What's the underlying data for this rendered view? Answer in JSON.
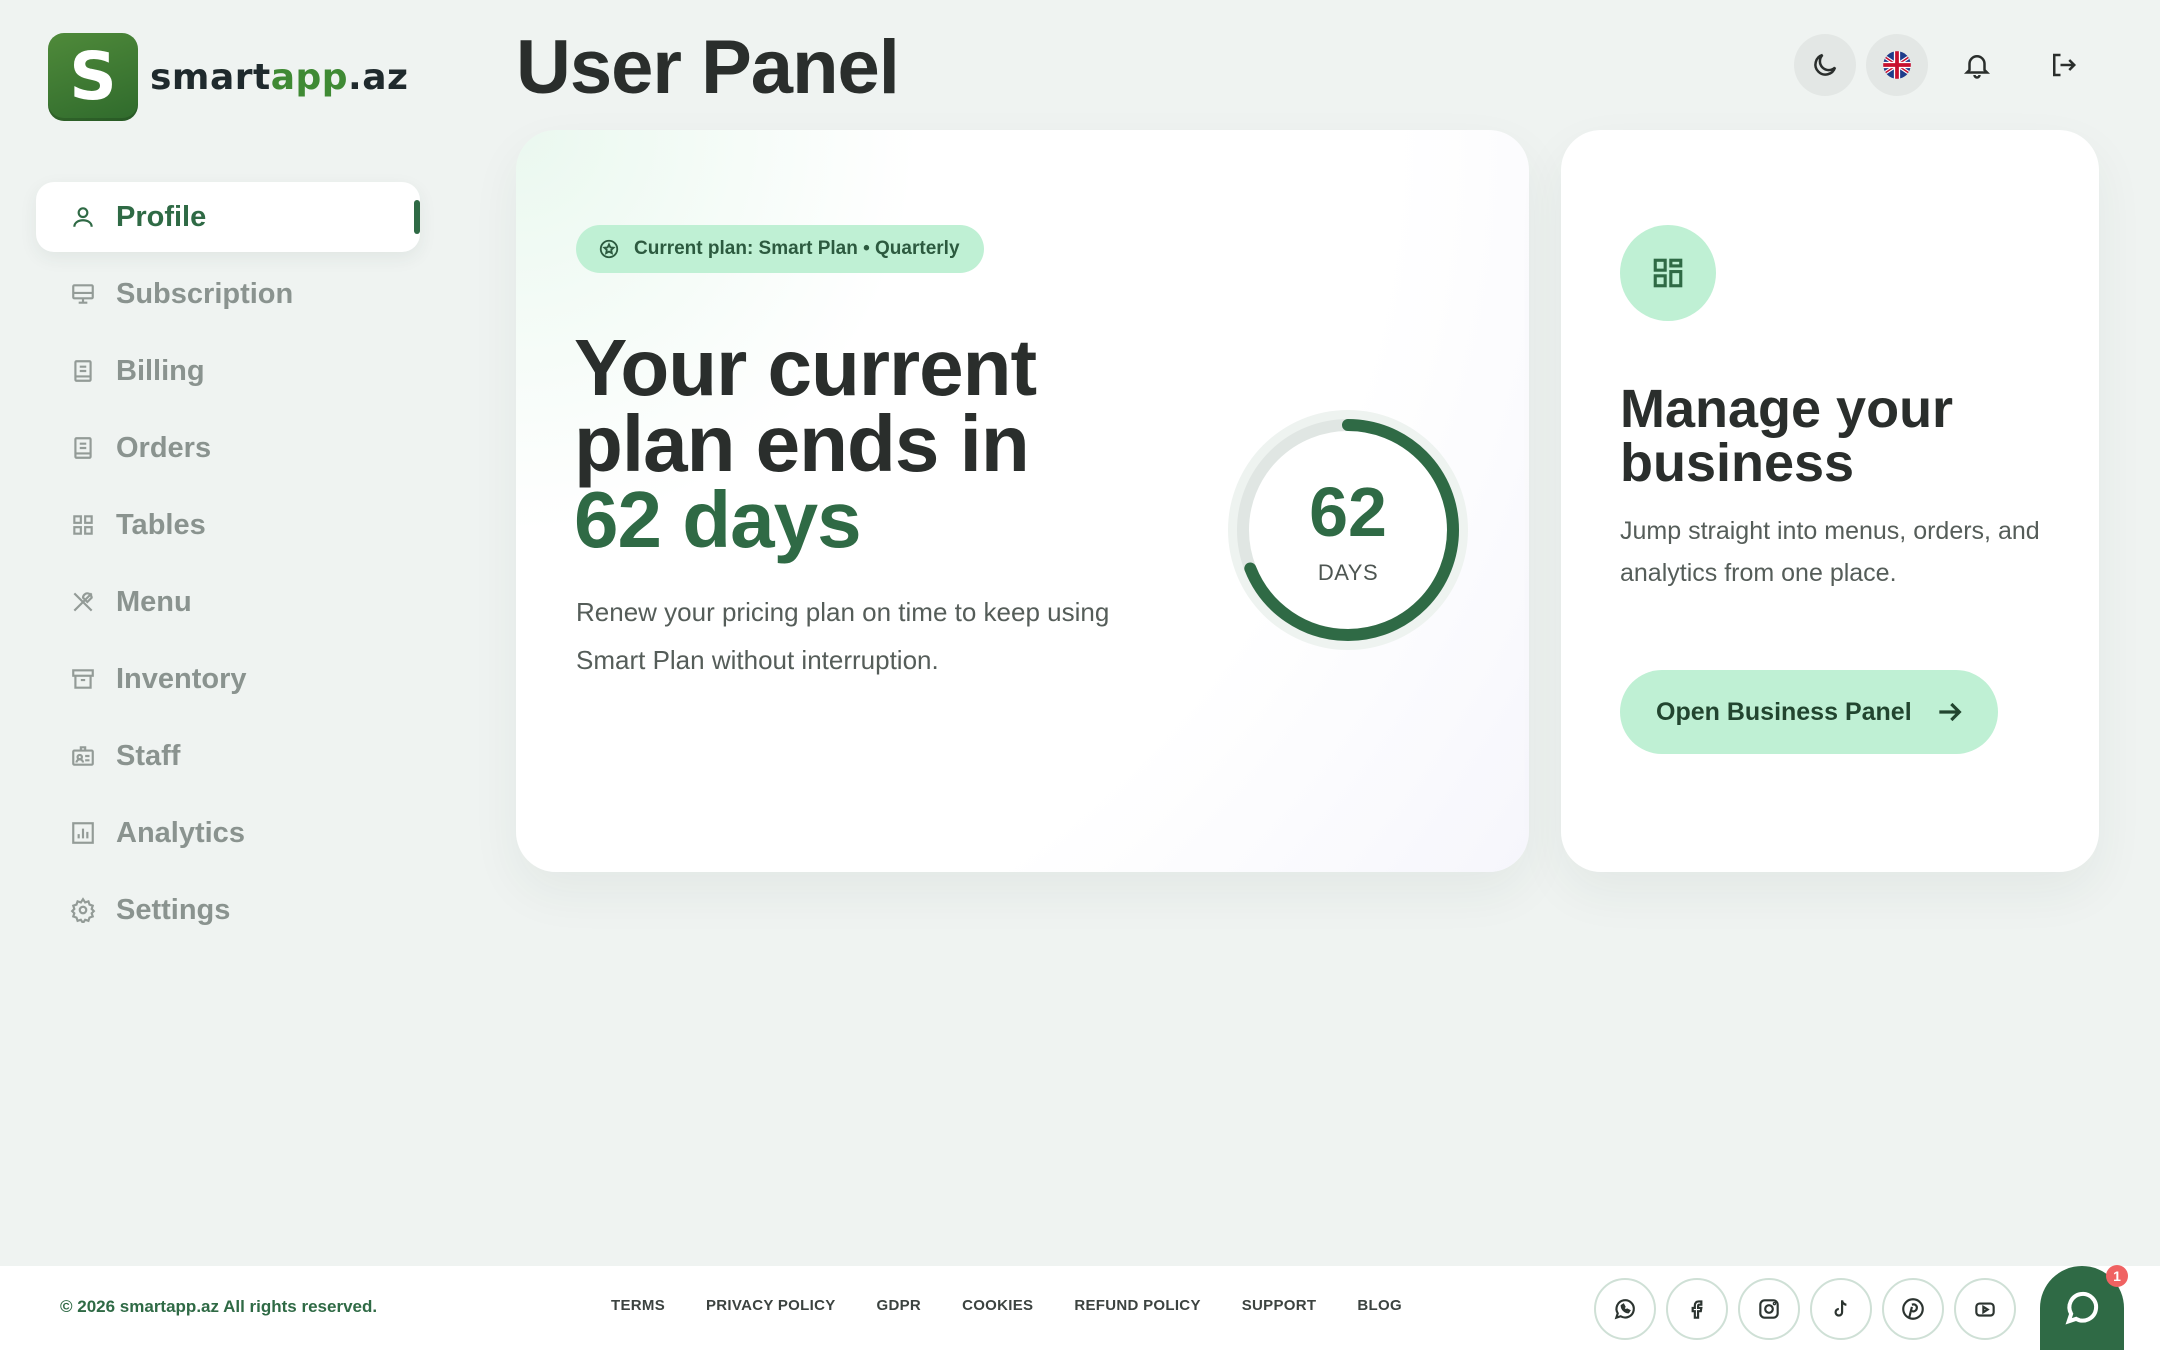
{
  "brand": {
    "logo_letter": "S",
    "name_part1": "smart",
    "name_part2": "app",
    "name_part3": ".az"
  },
  "page": {
    "title": "User Panel"
  },
  "sidebar": {
    "items": [
      {
        "label": "Profile",
        "icon": "user-icon",
        "active": true
      },
      {
        "label": "Subscription",
        "icon": "monitor-icon"
      },
      {
        "label": "Billing",
        "icon": "receipt-icon"
      },
      {
        "label": "Orders",
        "icon": "receipt-icon"
      },
      {
        "label": "Tables",
        "icon": "grid-icon"
      },
      {
        "label": "Menu",
        "icon": "utensils-icon"
      },
      {
        "label": "Inventory",
        "icon": "archive-icon"
      },
      {
        "label": "Staff",
        "icon": "id-card-icon"
      },
      {
        "label": "Analytics",
        "icon": "chart-icon"
      },
      {
        "label": "Settings",
        "icon": "gear-icon"
      }
    ]
  },
  "plan": {
    "chip": "Current plan: Smart Plan • Quarterly",
    "headline_line1": "Your current",
    "headline_line2": "plan ends in",
    "headline_highlight": "62 days",
    "description": "Renew your pricing plan on time to keep using Smart Plan without interruption.",
    "days_left": "62",
    "days_label": "DAYS",
    "progress_fraction": 0.69
  },
  "business": {
    "title": "Manage your business",
    "description": "Jump straight into menus, orders, and analytics from one place.",
    "button_label": "Open Business Panel"
  },
  "footer": {
    "copyright": "© 2026 smartapp.az All rights reserved.",
    "links": [
      "TERMS",
      "PRIVACY POLICY",
      "GDPR",
      "COOKIES",
      "REFUND POLICY",
      "SUPPORT",
      "BLOG"
    ],
    "chat_badge": "1"
  },
  "colors": {
    "primary": "#2f6a45",
    "mint": "#bff0d4",
    "background": "#eff3f1"
  }
}
